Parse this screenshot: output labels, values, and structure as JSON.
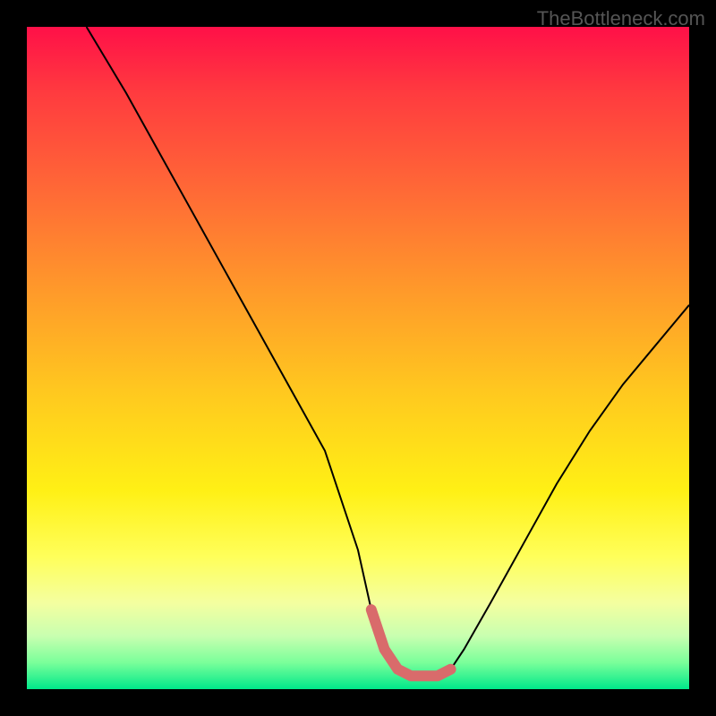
{
  "watermark": "TheBottleneck.com",
  "chart_data": {
    "type": "line",
    "title": "",
    "xlabel": "",
    "ylabel": "",
    "xlim": [
      0,
      100
    ],
    "ylim": [
      0,
      100
    ],
    "x": [
      9,
      15,
      20,
      25,
      30,
      35,
      40,
      45,
      50,
      52,
      54,
      56,
      58,
      60,
      62,
      64,
      66,
      70,
      75,
      80,
      85,
      90,
      95,
      100
    ],
    "values": [
      100,
      90,
      81,
      72,
      63,
      54,
      45,
      36,
      21,
      12,
      6,
      3,
      2,
      2,
      2,
      3,
      6,
      13,
      22,
      31,
      39,
      46,
      52,
      58
    ],
    "highlight": {
      "x_range": [
        52,
        64
      ],
      "y": 2.5,
      "color": "#d96b6b"
    },
    "gradient_stops": [
      {
        "pos": 0.0,
        "color": "#ff1048"
      },
      {
        "pos": 0.25,
        "color": "#ff6a36"
      },
      {
        "pos": 0.55,
        "color": "#ffc81f"
      },
      {
        "pos": 0.8,
        "color": "#ffff5a"
      },
      {
        "pos": 1.0,
        "color": "#00e88a"
      }
    ]
  }
}
